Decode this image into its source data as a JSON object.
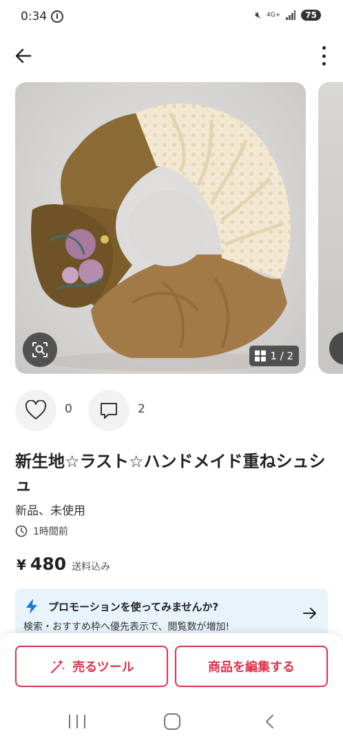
{
  "status_bar": {
    "time": "0:34",
    "network": "4G+",
    "battery": "75"
  },
  "icons": {
    "back": "back-arrow-icon",
    "more": "more-vertical-icon",
    "lens": "image-search-icon",
    "grid": "grid-icon",
    "like": "heart-icon",
    "comment": "comment-icon",
    "clock": "clock-icon",
    "bolt": "lightning-icon",
    "arrow": "arrow-right-icon",
    "sparkle": "sparkle-magic-icon"
  },
  "gallery": {
    "counter": "1 / 2"
  },
  "social": {
    "likes": "0",
    "comments": "2"
  },
  "item": {
    "title": "新生地☆ラスト☆ハンドメイド重ねシュシュ",
    "condition": "新品、未使用",
    "posted": "1時間前",
    "currency": "¥",
    "price": "480",
    "shipping": "送料込み"
  },
  "promo": {
    "title": "プロモーションを使ってみませんか?",
    "subtitle": "検索・おすすめ枠へ優先表示で、閲覧数が増加!"
  },
  "buttons": {
    "sell_tools": "売るツール",
    "edit": "商品を編集する"
  },
  "colors": {
    "accent": "#e0304a",
    "promo_bg": "#e8f3fc",
    "bolt": "#1a73e8"
  }
}
